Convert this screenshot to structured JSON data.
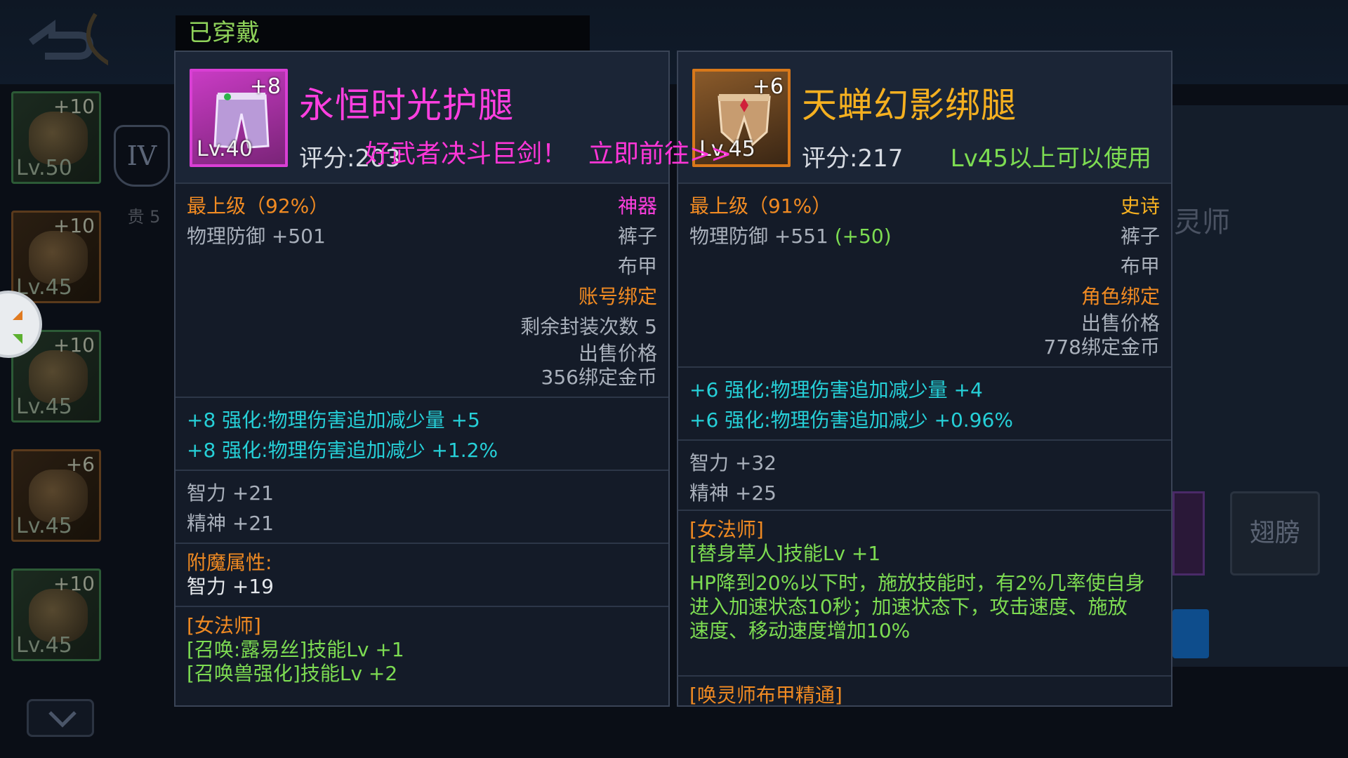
{
  "window": {
    "equipped_label": "已穿戴"
  },
  "left_item": {
    "name": "永恒时光护腿",
    "enhance": "+8",
    "level": "Lv.40",
    "score": "评分:203",
    "grade": "最上级（92%）",
    "rarity": "神器",
    "stat_main": "物理防御 +501",
    "slot_type": "裤子",
    "armor_type": "布甲",
    "binding": "账号绑定",
    "seal_count": "剩余封装次数 5",
    "sell_label": "出售价格",
    "sell_price": "356绑定金币",
    "enhance_bonus": [
      "+8 强化:物理伤害追加减少量 +5",
      "+8 强化:物理伤害追加减少 +1.2%"
    ],
    "attributes": [
      "智力 +21",
      "精神 +21"
    ],
    "enchant_label": "附魔属性:",
    "enchant_value": "智力 +19",
    "class_label": "[女法师]",
    "class_skills": [
      "[召唤:露易丝]技能Lv +1",
      "[召唤兽强化]技能Lv +2"
    ]
  },
  "right_item": {
    "name": "天蝉幻影绑腿",
    "enhance": "+6",
    "level": "Lv.45",
    "score": "评分:217",
    "usable": "Lv45以上可以使用",
    "grade": "最上级（91%）",
    "rarity": "史诗",
    "stat_main": "物理防御 +551",
    "stat_diff": "(+50)",
    "slot_type": "裤子",
    "armor_type": "布甲",
    "binding": "角色绑定",
    "sell_label": "出售价格",
    "sell_price": "778绑定金币",
    "enhance_bonus": [
      "+6 强化:物理伤害追加减少量 +4",
      "+6 强化:物理伤害追加减少 +0.96%"
    ],
    "attributes": [
      "智力 +32",
      "精神 +25"
    ],
    "class_label": "[女法师]",
    "class_skill": "[替身草人]技能Lv +1",
    "skill_desc": [
      "HP降到20%以下时，施放技能时，有2%几率使自身",
      "进入加速状态10秒；加速状态下，攻击速度、施放",
      "速度、移动速度增加10%"
    ],
    "set_label": "[唤灵师布甲精通]"
  },
  "notice": {
    "text": "好武者决斗巨剑！",
    "link": "立即前往>>"
  },
  "background": {
    "side_slots": [
      {
        "plus": "+10",
        "lv": "Lv.50"
      },
      {
        "plus": "+10",
        "lv": "Lv.45"
      },
      {
        "plus": "+10",
        "lv": "Lv.45"
      },
      {
        "plus": "+6",
        "lv": "Lv.45"
      },
      {
        "plus": "+10",
        "lv": "Lv.45"
      }
    ],
    "rank_roman": "IV",
    "rank_tag": "贵 5",
    "class_title": "灵师",
    "wings_label": "翅膀"
  },
  "colors": {
    "rarity_artifact": "#ff3fe0",
    "rarity_epic": "#f5b020",
    "grade": "#f08a22",
    "enhance": "#26d0d8",
    "usable": "#7ddc52"
  }
}
